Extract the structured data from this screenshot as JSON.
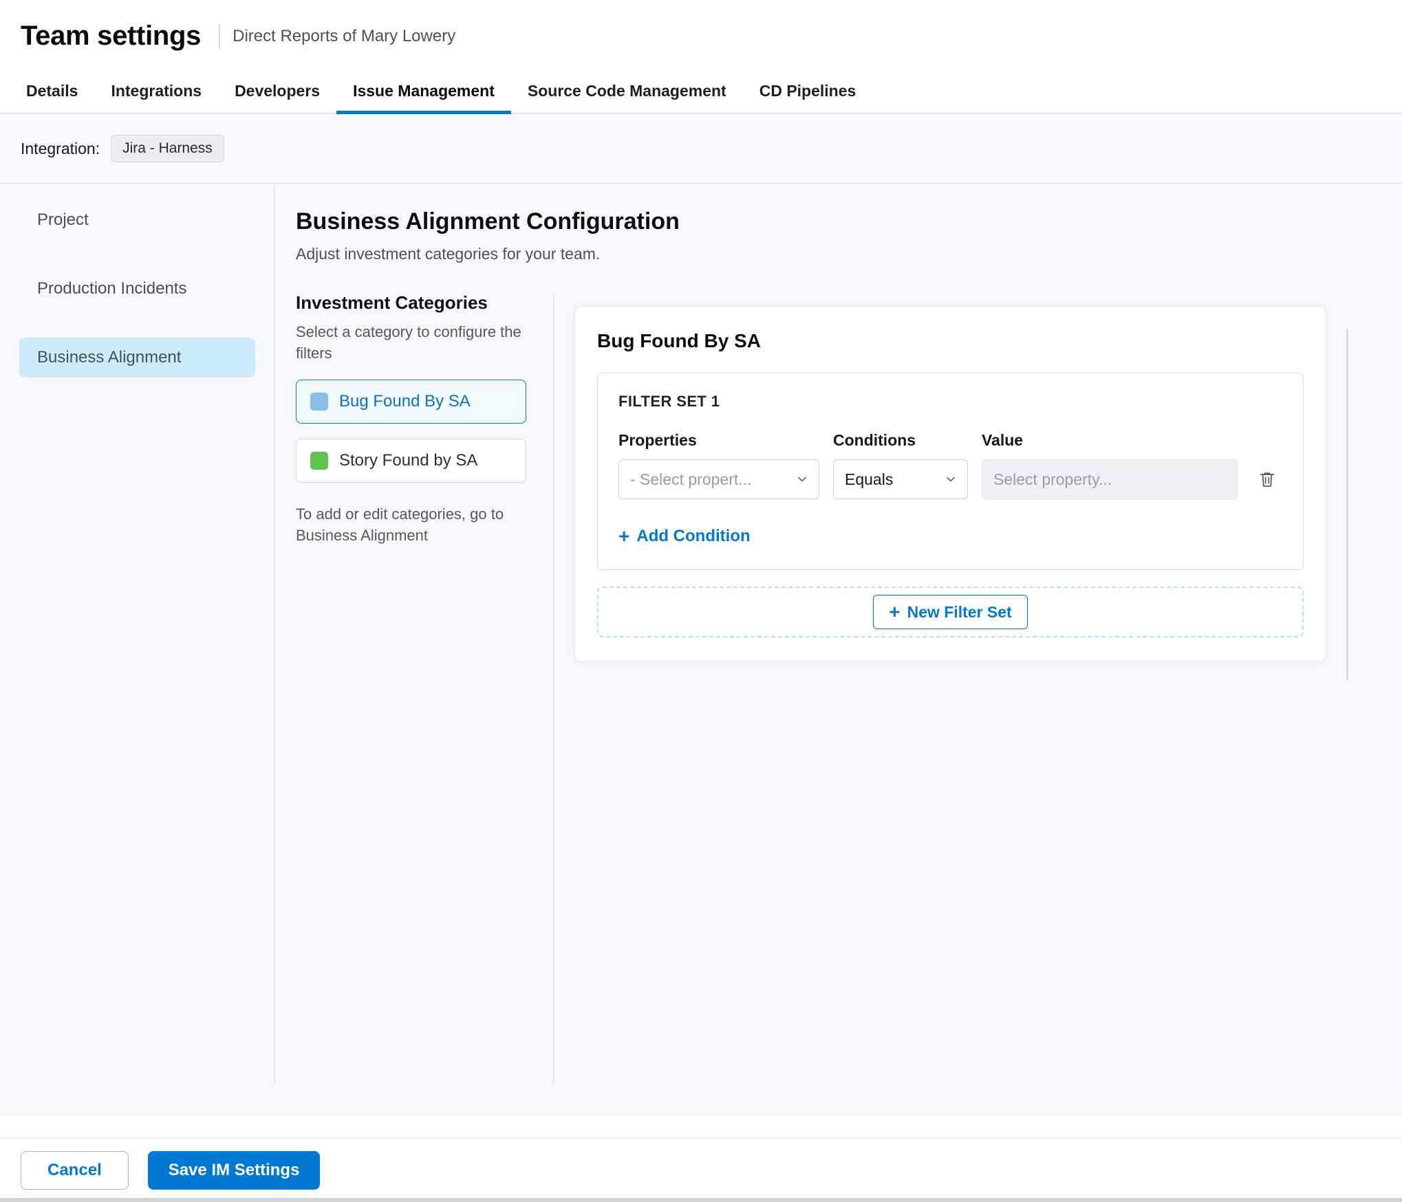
{
  "header": {
    "title": "Team settings",
    "subtitle": "Direct Reports of Mary Lowery"
  },
  "tabs": [
    {
      "label": "Details",
      "active": false
    },
    {
      "label": "Integrations",
      "active": false
    },
    {
      "label": "Developers",
      "active": false
    },
    {
      "label": "Issue Management",
      "active": true
    },
    {
      "label": "Source Code Management",
      "active": false
    },
    {
      "label": "CD Pipelines",
      "active": false
    }
  ],
  "integration": {
    "label": "Integration:",
    "value": "Jira - Harness"
  },
  "sidebar": {
    "items": [
      {
        "label": "Project",
        "active": false
      },
      {
        "label": "Production Incidents",
        "active": false
      },
      {
        "label": "Business Alignment",
        "active": true
      }
    ]
  },
  "main": {
    "title": "Business Alignment Configuration",
    "subtitle": "Adjust investment categories for your team.",
    "categories_section": {
      "title": "Investment Categories",
      "description": "Select a category to configure the filters",
      "items": [
        {
          "label": "Bug Found By SA",
          "color": "#86bce8",
          "selected": true
        },
        {
          "label": "Story Found by SA",
          "color": "#5cc44f",
          "selected": false
        }
      ],
      "note": "To add or edit categories, go to Business Alignment"
    },
    "filter_panel": {
      "title": "Bug Found By SA",
      "filter_set": {
        "title": "FILTER SET 1",
        "columns": [
          "Properties",
          "Conditions",
          "Value"
        ],
        "property_placeholder": "- Select propert...",
        "condition_value": "Equals",
        "value_placeholder": "Select property...",
        "add_condition_label": "Add Condition"
      },
      "new_filter_set_label": "New Filter Set"
    }
  },
  "footer": {
    "cancel_label": "Cancel",
    "save_label": "Save IM Settings"
  },
  "colors": {
    "accent": "#0278d5",
    "sidebar_selected_bg": "#cdecf9",
    "category_selected_bg": "#f2fbff",
    "dashed_border": "#b5e3f3"
  }
}
